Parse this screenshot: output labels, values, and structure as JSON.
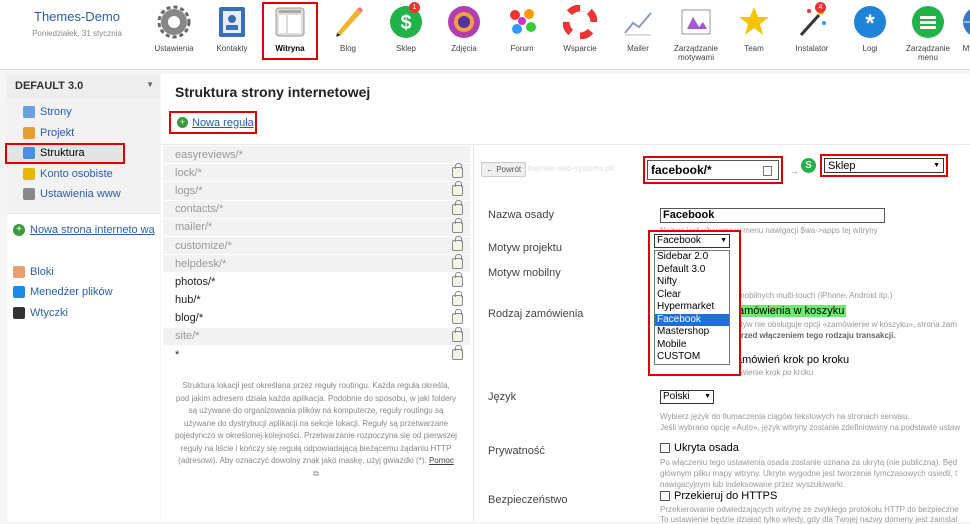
{
  "brand": {
    "title": "Themes-Demo",
    "date": "Poniedziałek, 31 stycznia"
  },
  "apps": [
    {
      "label": "Ustawienia",
      "icon": "gear-icon"
    },
    {
      "label": "Kontakty",
      "icon": "contacts-icon"
    },
    {
      "label": "Witryna",
      "icon": "site-icon",
      "active": true
    },
    {
      "label": "Blog",
      "icon": "pencil-icon"
    },
    {
      "label": "Sklep",
      "icon": "shop-icon",
      "badge": "1"
    },
    {
      "label": "Zdjęcia",
      "icon": "camera-icon"
    },
    {
      "label": "Forum",
      "icon": "forum-icon"
    },
    {
      "label": "Wsparcie",
      "icon": "lifebuoy-icon"
    },
    {
      "label": "Mailer",
      "icon": "mailer-icon"
    },
    {
      "label": "Zarządzanie motywami",
      "icon": "themes-icon"
    },
    {
      "label": "Team",
      "icon": "team-icon"
    },
    {
      "label": "Instalator",
      "icon": "installer-icon",
      "badge": "4"
    },
    {
      "label": "Logi",
      "icon": "logs-icon"
    },
    {
      "label": "Zarządzanie menu",
      "icon": "menu-icon"
    },
    {
      "label": "My Lang",
      "icon": "lang-icon"
    }
  ],
  "sidebar": {
    "site_name": "DEFAULT 3.0",
    "items": [
      {
        "label": "Strony",
        "icon": "pages-icon"
      },
      {
        "label": "Projekt",
        "icon": "palette-icon"
      },
      {
        "label": "Struktura",
        "icon": "structure-icon",
        "selected": true
      },
      {
        "label": "Konto osobiste",
        "icon": "key-icon"
      },
      {
        "label": "Ustawienia www",
        "icon": "gear-icon"
      }
    ],
    "new_site": "Nowa strona interneto wa",
    "bottom": [
      {
        "label": "Bloki",
        "icon": "blocks-icon"
      },
      {
        "label": "Menedżer plików",
        "icon": "upload-icon"
      },
      {
        "label": "Wtyczki",
        "icon": "plug-icon"
      }
    ]
  },
  "main": {
    "title": "Struktura strony internetowej",
    "new_rule": "Nowa reguła",
    "rules": [
      {
        "path": "easyreviews/*",
        "bright": false,
        "lock": false
      },
      {
        "path": "lock/*",
        "bright": false,
        "lock": true
      },
      {
        "path": "logs/*",
        "bright": false,
        "lock": true
      },
      {
        "path": "contacts/*",
        "bright": false,
        "lock": true
      },
      {
        "path": "mailer/*",
        "bright": false,
        "lock": true
      },
      {
        "path": "customize/*",
        "bright": false,
        "lock": true
      },
      {
        "path": "helpdesk/*",
        "bright": false,
        "lock": true
      },
      {
        "path": "photos/*",
        "bright": true,
        "lock": true
      },
      {
        "path": "hub/*",
        "bright": true,
        "lock": true
      },
      {
        "path": "blog/*",
        "bright": true,
        "lock": true
      },
      {
        "path": "site/*",
        "bright": false,
        "lock": true
      },
      {
        "path": "*",
        "bright": true,
        "lock": true
      }
    ],
    "help_text": "Struktura lokacji jest określana przez reguły routingu. Każda reguła określa, pod jakim adresem działa każda aplikacja. Podobnie do sposobu, w jaki foldery są używane do organizowania plików na komputerze, reguły routingu są używane do dystrybucji aplikacji na sekcje lokacji. Reguły są przetwarzane pojedynczo w określonej kolejności. Przetwarzanie rozpoczyna się od pierwszej reguły na liście i kończy się regułą odpowiadającą bieżącemu żądaniu HTTP (adresowi). Aby oznaczyć dowolny znak jako maskę, użyj gwiazdki (*).",
    "help_link": "Pomoc"
  },
  "editor": {
    "back": "← Powrót",
    "ghost": "themes-web-systems.pl/",
    "url": "facebook/*",
    "arrow": "→",
    "app_icon": "S",
    "app_value": "Sklep",
    "fields": {
      "nazwa_label": "Nazwa osady",
      "nazwa_value": "Facebook",
      "nazwa_hint": "Nazwa jest używana w menu nawigacji $wa->apps tej witryny",
      "motyw_label": "Motyw projektu",
      "motyw_mobile_label": "Motyw mobilny",
      "mobile_hint": "mobilnych multi-touch (iPhone, Android itp.)",
      "rodzaj_label": "Rodzaj zamówienia",
      "option1": "amówienia w koszyku",
      "option1_hint1": "otyw nie obsługuje opcji «zamówienie w koszyku», strona zam",
      "option1_hint2": "przed włączeniem tego rodzaju transakcji.",
      "option2": "amówień krok po kroku",
      "option2_hint": "ówienie krok po kroku",
      "jezyk_label": "Język",
      "jezyk_value": "Polski",
      "jezyk_hint1": "Wybierz język do tłumaczenia ciągów tekstowych na stronach serwisu.",
      "jezyk_hint2": "Jeśli wybrano opcję «Auto», język witryny zostanie zdefiniowany na podstawie ustaw",
      "prywatnosc_label": "Prywatność",
      "ukryta": "Ukryta osada",
      "ukryta_hint1": "Po włączeniu tego ustawienia osada zostanie uznana za ukrytą (nie publiczną). Będ",
      "ukryta_hint2": "głównym pliku mapy witryny. Ukryte wygodne jest tworzenie tymczasowych osiedli, t",
      "ukryta_hint3": "nawigacyjnym lub indeksowane przez wyszukiwarki.",
      "bezp_label": "Bezpieczeństwo",
      "https": "Przekieruj do HTTPS",
      "https_hint1": "Przekierowanie odwiedzających witrynę ze zwykłego protokołu HTTP do bezpieczne",
      "https_hint2": "To ustawienie będzie działać tylko wtedy, gdy dla Twojej nazwy domeny jest zainstal"
    }
  },
  "theme_dropdown": {
    "value": "Facebook",
    "options": [
      "Sidebar 2.0",
      "Default 3.0",
      "Nifty",
      "Clear",
      "Hypermarket",
      "Facebook",
      "Mastershop",
      "Mobile",
      "CUSTOM"
    ],
    "highlighted": "Facebook"
  },
  "colors": {
    "accent": "#2a5db0",
    "highlight": "#d00000",
    "green": "#21b24a"
  }
}
